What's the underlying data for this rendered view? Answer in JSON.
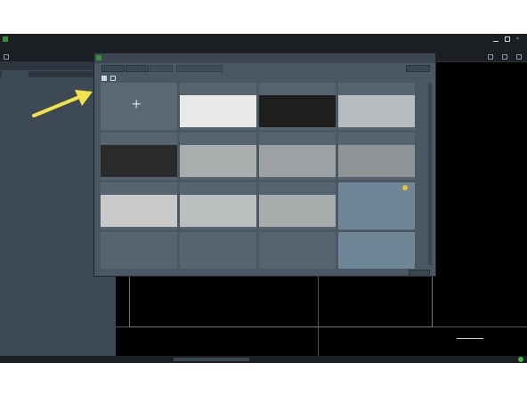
{
  "titlebar": {
    "app_title": "",
    "brand": ""
  },
  "menubar": {
    "items": []
  },
  "left_panel": {
    "template_label": "",
    "template_value": "",
    "tabs": []
  },
  "dialog": {
    "title": "",
    "toolbar_buttons": [],
    "refresh_label": "",
    "quit_label": "",
    "tiles": []
  },
  "viewport": {
    "scale_label": ""
  },
  "statusbar": {
    "left_text": "",
    "job_text": "",
    "right_text": ""
  },
  "colors": {
    "accent": "#f3e34a",
    "dialog_bg": "#4a5864",
    "panel_bg": "#3d4a55"
  }
}
